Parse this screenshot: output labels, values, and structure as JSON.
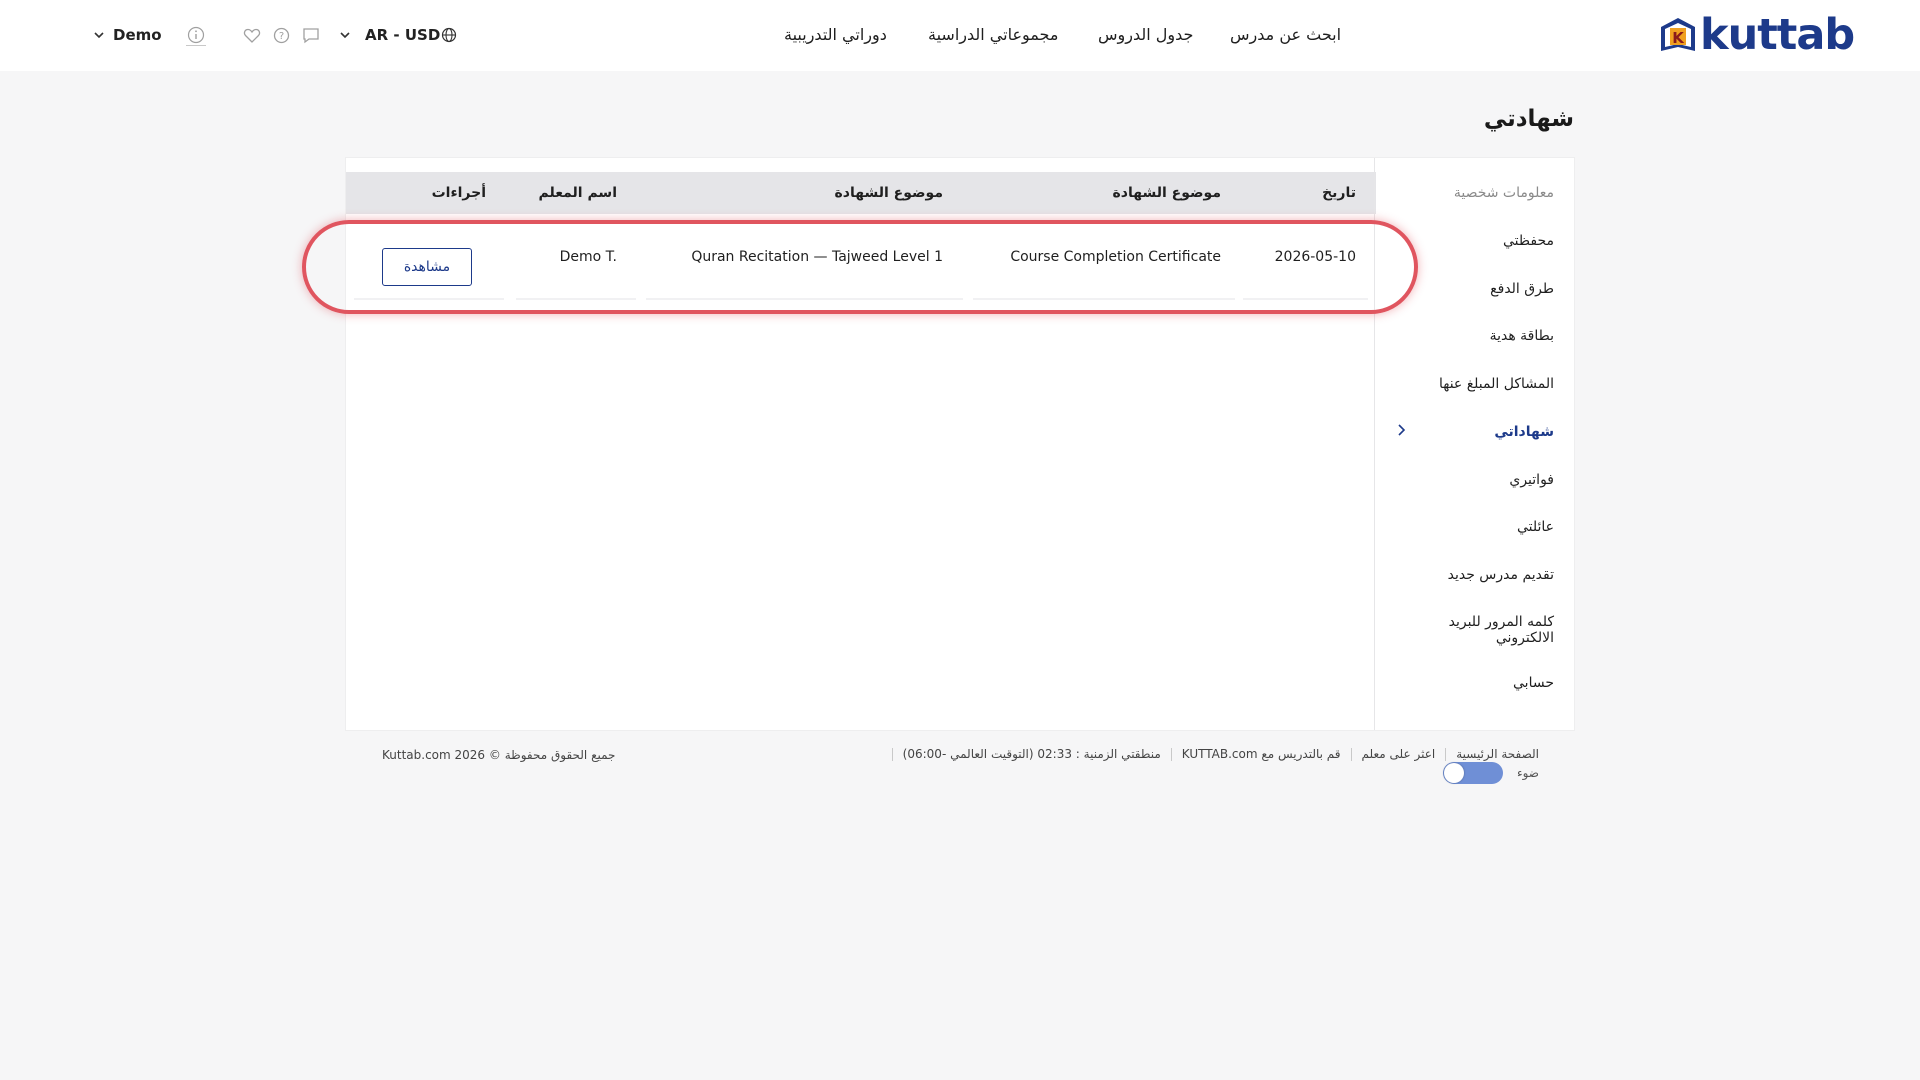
{
  "header": {
    "logo_text": "kuttab",
    "logo_letter": "K",
    "nav": {
      "find_teacher": "ابحث عن مدرس",
      "lessons_schedule": "جدول الدروس",
      "study_groups": "مجموعاتي الدراسية",
      "training_courses": "دوراتي التدريبية"
    },
    "currency_label": "AR - USD",
    "user_name": "Demo"
  },
  "page": {
    "title": "شهادتي"
  },
  "sidebar": {
    "items": [
      {
        "label": "معلومات شخصية"
      },
      {
        "label": "محفظتي"
      },
      {
        "label": "طرق الدفع"
      },
      {
        "label": "بطاقة هدية"
      },
      {
        "label": "المشاكل المبلغ عنها"
      },
      {
        "label": "شهاداتي"
      },
      {
        "label": "فواتيري"
      },
      {
        "label": "عائلتي"
      },
      {
        "label": "تقديم مدرس جديد"
      },
      {
        "label": "كلمه المرور للبريد الالكتروني"
      },
      {
        "label": "حسابي"
      }
    ],
    "active_index": 5
  },
  "table": {
    "columns": [
      "تاريخ",
      "موضوع الشهادة",
      "موضوع الشهادة",
      "اسم المعلم",
      "أجراءات"
    ],
    "rows": [
      {
        "date": "2026-05-10",
        "certificate": "Course Completion Certificate",
        "subject": "Quran Recitation — Tajweed Level 1",
        "teacher": "Demo T.",
        "action_label": "مشاهدة"
      }
    ]
  },
  "footer": {
    "links": [
      "الصفحة الرئيسية",
      "اعثر على معلم",
      "قم بالتدريس مع KUTTAB.com",
      "منطقتي الزمنية : 02:33 (التوقيت العالمي -06:00)"
    ],
    "copyright": "جميع الحقوق محفوظة © 2026 Kuttab.com",
    "theme_label": "ضوء"
  },
  "colors": {
    "brand": "#1d3a8a",
    "highlight": "#e0555f",
    "toggle": "#6f8fd6"
  }
}
